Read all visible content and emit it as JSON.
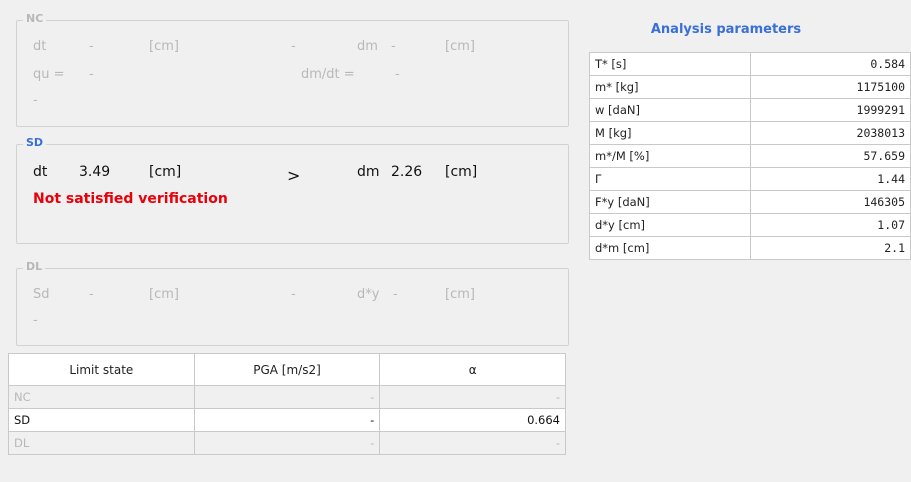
{
  "nc": {
    "legend": "NC",
    "dt_label": "dt",
    "dt_value": "-",
    "dt_unit": "[cm]",
    "cmp": "-",
    "dm_label": "dm",
    "dm_value": "-",
    "dm_unit": "[cm]",
    "qu_label": "qu =",
    "qu_value": "-",
    "dmdt_label": "dm/dt =",
    "dmdt_value": "-",
    "status": "-"
  },
  "sd": {
    "legend": "SD",
    "dt_label": "dt",
    "dt_value": "3.49",
    "dt_unit": "[cm]",
    "cmp": ">",
    "dm_label": "dm",
    "dm_value": "2.26",
    "dm_unit": "[cm]",
    "status": "Not satisfied verification"
  },
  "dl": {
    "legend": "DL",
    "sd_label": "Sd",
    "sd_value": "-",
    "sd_unit": "[cm]",
    "cmp": "-",
    "dy_label": "d*y",
    "dy_value": "-",
    "dy_unit": "[cm]",
    "status": "-"
  },
  "limit_table": {
    "headers": [
      "Limit state",
      "PGA [m/s2]",
      "α"
    ],
    "rows": [
      {
        "state": "NC",
        "pga": "-",
        "alpha": "-"
      },
      {
        "state": "SD",
        "pga": "-",
        "alpha": "0.664"
      },
      {
        "state": "DL",
        "pga": "-",
        "alpha": "-"
      }
    ]
  },
  "params": {
    "title": "Analysis parameters",
    "rows": [
      {
        "label": "T* [s]",
        "value": "0.584"
      },
      {
        "label": "m* [kg]",
        "value": "1175100"
      },
      {
        "label": "w [daN]",
        "value": "1999291"
      },
      {
        "label": "M [kg]",
        "value": "2038013"
      },
      {
        "label": "m*/M [%]",
        "value": "57.659"
      },
      {
        "label": "Γ",
        "value": "1.44"
      },
      {
        "label": "F*y [daN]",
        "value": "146305"
      },
      {
        "label": "d*y [cm]",
        "value": "1.07"
      },
      {
        "label": "d*m [cm]",
        "value": "2.1"
      }
    ]
  },
  "colors": {
    "accent": "#3a6fd8",
    "error": "#e8000b",
    "disabled_text": "#b8b8b8",
    "background": "#f0f0f0"
  }
}
